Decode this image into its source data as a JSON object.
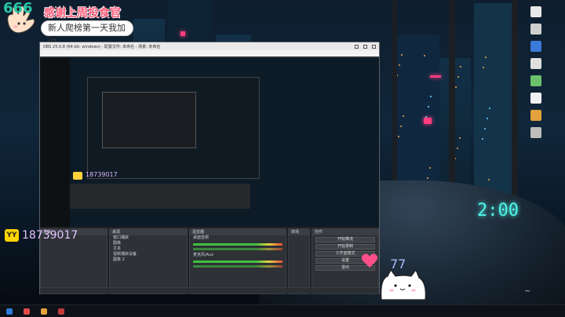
{
  "overlay_top": {
    "counter": "666",
    "thanks": "感谢上周投食官",
    "subtitle": "新人爬榜第一天我加油"
  },
  "obs_window": {
    "title": "OBS 25.0.8 (64-bit, windows) - 配置文件: 未命名 - 场景: 未命名",
    "nested_overlay_thanks": "感谢上周投食官",
    "nested_id": "18739017",
    "docks": {
      "scenes_header": "场景",
      "sources_header": "来源",
      "mixer_header": "混音器",
      "transitions_header": "转场",
      "controls_header": "控件",
      "sources": [
        "窗口捕获",
        "图像",
        "文本",
        "视频捕获设备",
        "图像 2"
      ],
      "mixer_channels": [
        "桌面音频",
        "麦克风/Aux"
      ],
      "controls": [
        "开始推流",
        "开始录制",
        "工作室模式",
        "设置",
        "退出"
      ]
    }
  },
  "stream_overlay": {
    "platform_logo": "YY",
    "room_id": "18739017",
    "like_count": "77"
  },
  "neon_clock": "2:00",
  "taskbar": {
    "items": [
      {
        "label": "",
        "color": "#2d7bd8"
      },
      {
        "label": "",
        "color": "#e24a4a"
      },
      {
        "label": "",
        "color": "#e6a23c"
      },
      {
        "label": "",
        "color": "#c23b3b"
      }
    ],
    "tray_time": "",
    "tray_date": ""
  },
  "colors": {
    "overlay_pink": "#ff5c7a",
    "yy_yellow": "#ffd400",
    "neon_cyan": "#4ff6e8",
    "heart": "#ff4f8b"
  }
}
